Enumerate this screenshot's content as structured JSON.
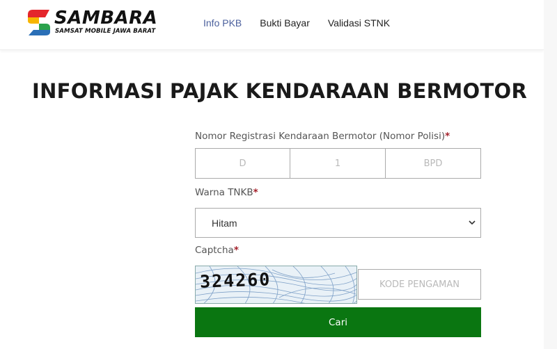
{
  "brand": {
    "title": "SAMBARA",
    "subtitle": "SAMSAT MOBILE JAWA BARAT",
    "colors": {
      "red": "#e4262c",
      "yellow": "#f7b500",
      "green": "#2ba24c",
      "blue": "#2a6fb7"
    }
  },
  "nav": {
    "items": [
      {
        "label": "Info PKB",
        "active": true
      },
      {
        "label": "Bukti Bayar",
        "active": false
      },
      {
        "label": "Validasi STNK",
        "active": false
      }
    ]
  },
  "page": {
    "title": "INFORMASI PAJAK KENDARAAN BERMOTOR"
  },
  "form": {
    "plate_label": "Nomor Registrasi Kendaraan Bermotor (Nomor Polisi)",
    "required_mark": "*",
    "plate_prefix_placeholder": "D",
    "plate_number_placeholder": "1",
    "plate_suffix_placeholder": "BPD",
    "color_label": "Warna TNKB",
    "color_selected": "Hitam",
    "captcha_label": "Captcha",
    "captcha_text": "324260",
    "captcha_placeholder": "KODE PENGAMAN",
    "submit_label": "Cari"
  },
  "accent_colors": {
    "nav_active": "#4a5f9c",
    "submit": "#0a7611",
    "required": "#a3202a"
  }
}
